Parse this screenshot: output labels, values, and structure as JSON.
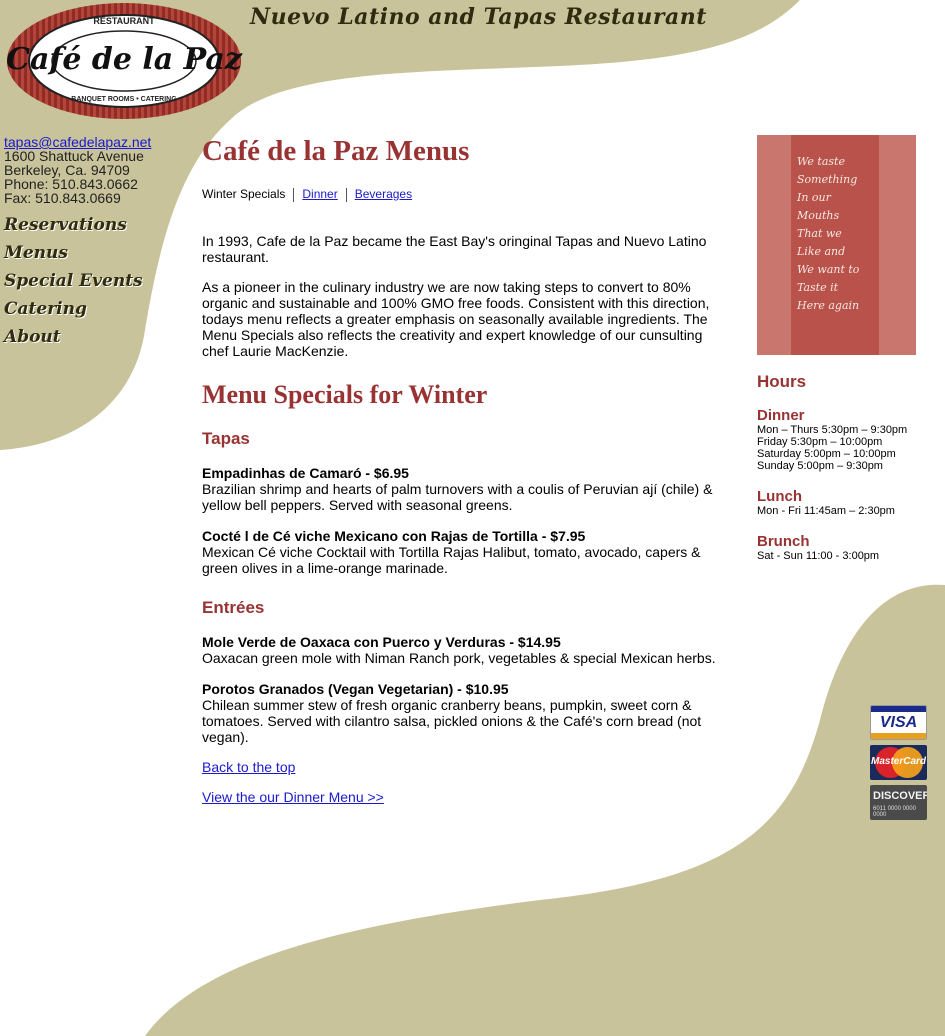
{
  "brand": {
    "logo_top": "RESTAURANT",
    "logo_name": "Café de la Paz",
    "logo_bottom": "BANQUET ROOMS • CATERING",
    "tagline": "Nuevo Latino and Tapas Restaurant"
  },
  "contact": {
    "email": "tapas@cafedelapaz.net",
    "address": "1600 Shattuck Avenue",
    "city": "Berkeley, Ca. 94709",
    "phone": "Phone: 510.843.0662",
    "fax": "Fax: 510.843.0669"
  },
  "nav": {
    "reservations": "Reservations",
    "menus": "Menus",
    "special_events": "Special Events",
    "catering": "Catering",
    "about": "About"
  },
  "main": {
    "title": "Café de la Paz Menus",
    "subnav": {
      "winter": "Winter Specials",
      "dinner": "Dinner",
      "beverages": "Beverages"
    },
    "intro1": "In 1993, Cafe de la Paz became the East Bay's oringinal Tapas and Nuevo Latino restaurant.",
    "intro2": "As a pioneer in the culinary industry we are now taking steps to convert to 80% organic and sustainable and 100% GMO free foods. Consistent with this direction, todays menu reflects a greater emphasis on seasonally available ingredients. The Menu Specials also reflects the creativity and expert knowledge of our cunsulting chef Laurie MacKenzie.",
    "specials_title": "Menu Specials for Winter",
    "tapas_title": "Tapas",
    "tapas": [
      {
        "name": "Empadinhas de Camaró - $6.95",
        "desc": "Brazilian shrimp and hearts of palm turnovers with a coulis of Peruvian ají (chile) & yellow bell peppers. Served with seasonal greens."
      },
      {
        "name": "Cocté l de Cé viche Mexicano con Rajas de Tortilla - $7.95",
        "desc": "Mexican Cé viche Cocktail with Tortilla Rajas Halibut, tomato, avocado, capers & green olives in a lime-orange marinade."
      }
    ],
    "entrees_title": "Entrées",
    "entrees": [
      {
        "name": "Mole Verde de Oaxaca con Puerco y Verduras - $14.95",
        "desc": "Oaxacan green mole with Niman Ranch pork, vegetables & special Mexican herbs."
      },
      {
        "name": "Porotos Granados (Vegan Vegetarian) - $10.95",
        "desc": "Chilean summer stew of fresh organic cranberry beans, pumpkin, sweet corn & tomatoes. Served with cilantro salsa, pickled onions & the Café's corn bread (not vegan)."
      }
    ],
    "back_to_top": "Back to the top",
    "view_dinner": "View the our Dinner Menu >>"
  },
  "poem": {
    "lines": [
      "We taste",
      "Something",
      "In our",
      "Mouths",
      "That we",
      "Like and",
      "We want to",
      "Taste it",
      "Here again"
    ]
  },
  "hours": {
    "title": "Hours",
    "dinner_title": "Dinner",
    "dinner": [
      "Mon – Thurs 5:30pm – 9:30pm",
      "Friday 5:30pm – 10:00pm",
      "Saturday 5:00pm – 10:00pm",
      "Sunday 5:00pm – 9:30pm"
    ],
    "lunch_title": "Lunch",
    "lunch": [
      "Mon - Fri 11:45am – 2:30pm"
    ],
    "brunch_title": "Brunch",
    "brunch": [
      "Sat - Sun 11:00 - 3:00pm"
    ]
  },
  "cards": {
    "visa": "VISA",
    "mastercard": "MasterCard",
    "discover": "DISCOVER",
    "discover_number": "6011 0000 0000 0000"
  },
  "colors": {
    "accent": "#993333",
    "swoosh": "#c8c39a",
    "link": "#1a1acc"
  }
}
